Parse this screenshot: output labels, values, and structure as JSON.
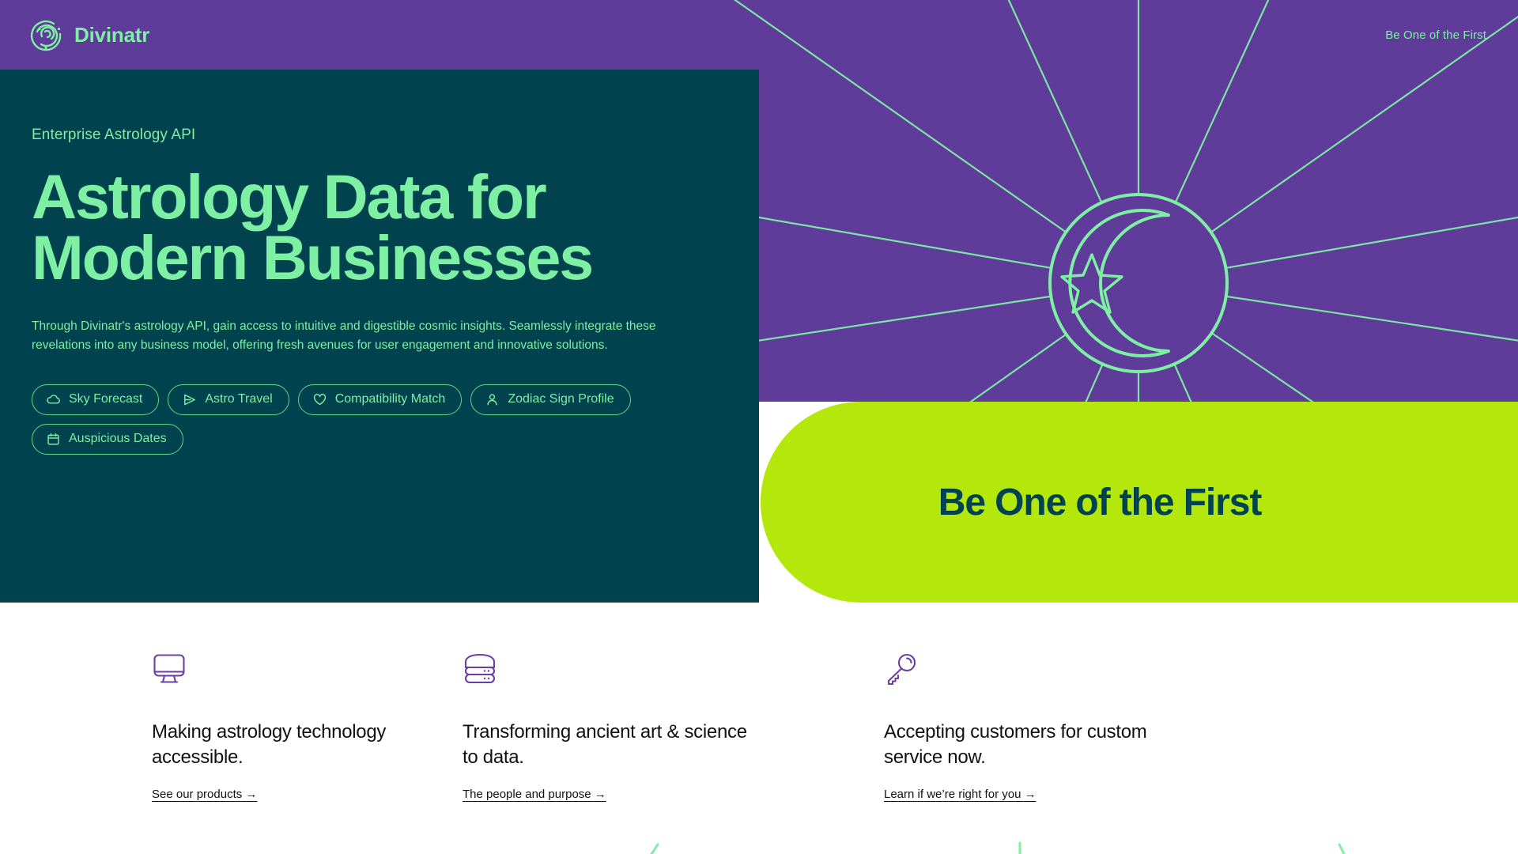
{
  "colors": {
    "purple": "#5F3C99",
    "teal": "#00424E",
    "mint": "#7DF0A4",
    "mint_border": "#5ADB8A",
    "lime": "#B4E80C",
    "white": "#FFFFFF",
    "feature_icon": "#6B3FA0",
    "feature_text": "#111111"
  },
  "nav": {
    "brand": "Divinatr",
    "brand_icon": "spiral-logo-icon",
    "link": "Be One of the First"
  },
  "hero": {
    "eyebrow": "Enterprise Astrology API",
    "headline_line1": "Astrology Data for",
    "headline_line2": "Modern Businesses",
    "subcopy": "Through Divinatr's astrology API, gain access to intuitive and digestible cosmic insights. Seamlessly integrate these revelations into any business model, offering fresh avenues for user engagement and innovative solutions.",
    "pills": [
      {
        "label": "Sky Forecast",
        "icon": "cloud-icon"
      },
      {
        "label": "Astro Travel",
        "icon": "send-icon"
      },
      {
        "label": "Compatibility Match",
        "icon": "heart-icon"
      },
      {
        "label": "Zodiac Sign Profile",
        "icon": "person-icon"
      },
      {
        "label": "Auspicious Dates",
        "icon": "calendar-icon"
      }
    ]
  },
  "illustration": {
    "name": "crescent-moon-star-burst",
    "elements": [
      "radiating-rays",
      "outer-circle",
      "crescent-moon",
      "five-point-star"
    ]
  },
  "cta": {
    "label": "Be One of the First"
  },
  "features": [
    {
      "icon": "monitor-icon",
      "title": "Making astrology technology accessible.",
      "link": "See our products →"
    },
    {
      "icon": "server-icon",
      "title": "Transforming ancient art & science to data.",
      "link": "The people and purpose →"
    },
    {
      "icon": "key-icon",
      "title": "Accepting customers for custom service now.",
      "link": "Learn if we’re right for you →"
    }
  ]
}
